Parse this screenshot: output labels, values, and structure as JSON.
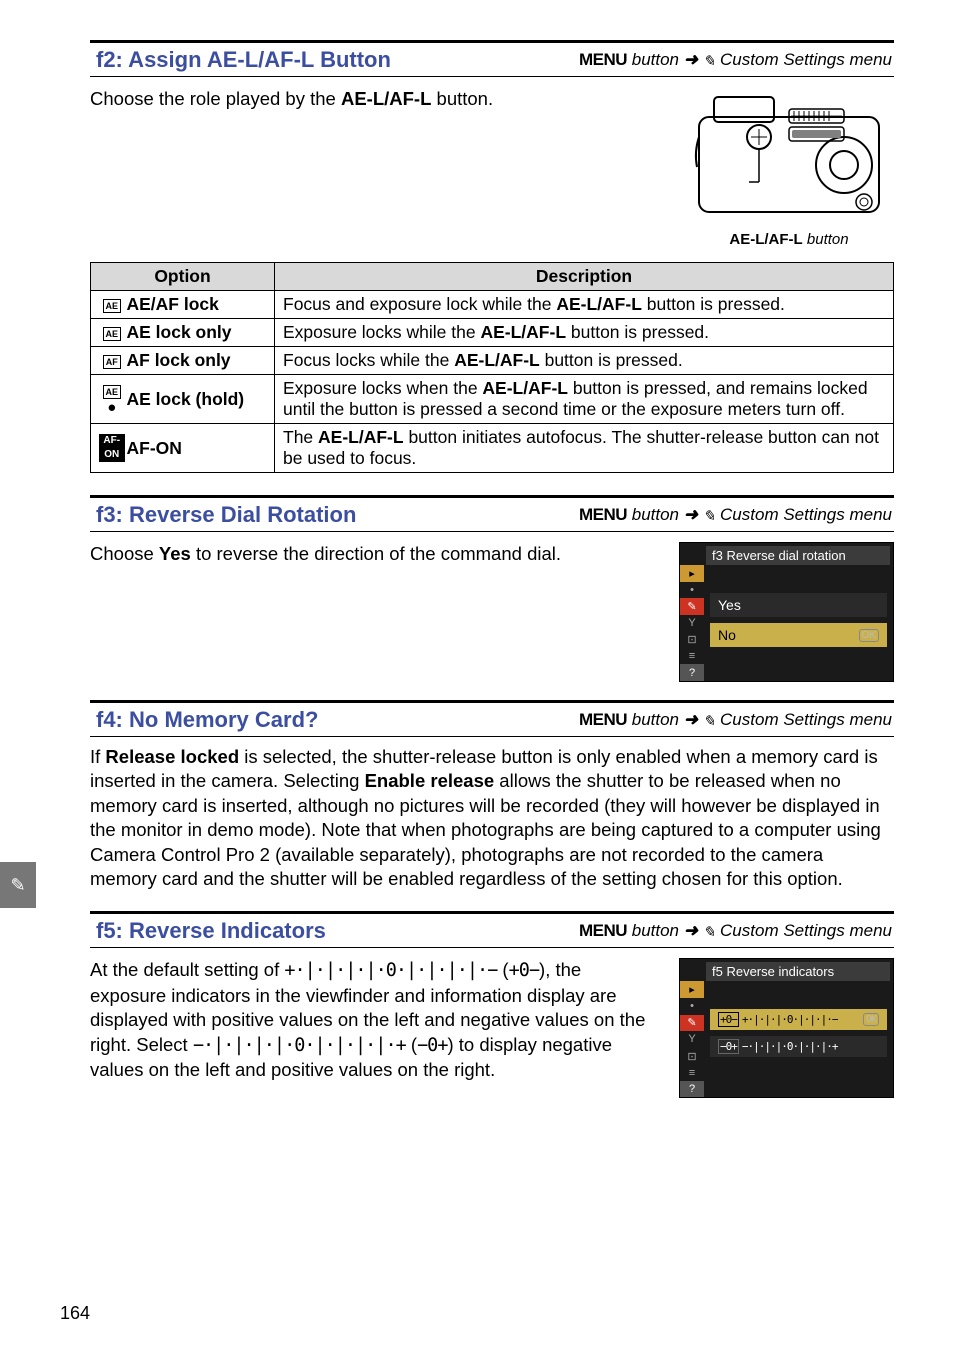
{
  "sidebar_glyph": "✎",
  "sections": {
    "f2": {
      "title": "f2: Assign AE-L/AF-L Button",
      "path_prefix": "MENU",
      "path_italic": "button",
      "path_arrow": "➜",
      "path_menu": "Custom Settings menu",
      "intro_before": "Choose the role played by the ",
      "intro_bold": "AE-L/AF-L",
      "intro_after": " button.",
      "button_caption_bold": "AE-L/AF-L",
      "button_caption_after": " button",
      "table": {
        "headers": {
          "option": "Option",
          "desc": "Description"
        },
        "rows": [
          {
            "icon": "AE-AF",
            "label": "AE/AF lock",
            "desc_pre": "Focus and exposure lock while the ",
            "desc_bold": "AE-L/AF-L",
            "desc_post": " button is pressed."
          },
          {
            "icon": "AE",
            "label": "AE lock only",
            "desc_pre": "Exposure locks while the ",
            "desc_bold": "AE-L/AF-L",
            "desc_post": " button is pressed."
          },
          {
            "icon": "AF",
            "label": "AF lock only",
            "desc_pre": "Focus locks while the ",
            "desc_bold": "AE-L/AF-L",
            "desc_post": " button is pressed."
          },
          {
            "icon": "AE-HOLD",
            "label": "AE lock (hold)",
            "desc_pre": "Exposure locks when the ",
            "desc_bold": "AE-L/AF-L",
            "desc_post": " button is pressed, and remains locked until the button is pressed a second time or the exposure meters turn off."
          },
          {
            "icon": "AF-ON",
            "label": "AF-ON",
            "desc_pre": "The ",
            "desc_bold": "AE-L/AF-L",
            "desc_post": " button initiates autofocus.  The shutter-release button can not be used to focus."
          }
        ]
      }
    },
    "f3": {
      "title": "f3: Reverse Dial Rotation",
      "path_prefix": "MENU",
      "path_italic": "button",
      "path_arrow": "➜",
      "path_menu": "Custom Settings menu",
      "intro_before": "Choose ",
      "intro_bold": "Yes",
      "intro_after": " to reverse the direction of the command dial.",
      "screenshot": {
        "title": "f3 Reverse dial rotation",
        "yes": "Yes",
        "no": "No",
        "ok": "OK"
      }
    },
    "f4": {
      "title": "f4: No Memory Card?",
      "path_prefix": "MENU",
      "path_italic": "button",
      "path_arrow": "➜",
      "path_menu": "Custom Settings menu",
      "body_parts": [
        "If ",
        {
          "b": "Release locked"
        },
        " is selected, the shutter-release button is only enabled when a memory card is inserted in the camera.  Selecting ",
        {
          "b": "Enable release"
        },
        " allows the shutter to be released when no memory card is inserted, although no pictures will be recorded (they will however be displayed in the monitor in demo mode).  Note that when photographs are being captured to a computer using Camera Control Pro 2 (available separately), photographs are not recorded to the camera memory card and the shutter will be enabled regardless of the setting chosen for this option."
      ]
    },
    "f5": {
      "title": "f5: Reverse Indicators",
      "path_prefix": "MENU",
      "path_italic": "button",
      "path_arrow": "➜",
      "path_menu": "Custom Settings menu",
      "body_parts": [
        "At the default setting of  ",
        {
          "m": "+·|·|·|·|·0·|·|·|·|·−"
        },
        "  (",
        {
          "m": "+0−"
        },
        "), the exposure indicators in the viewfinder and information display are displayed with positive values on the left and negative values on the right.  Select  ",
        {
          "m": "−·|·|·|·|·0·|·|·|·|·+"
        },
        "  (",
        {
          "m": "−0+"
        },
        ") to display negative values on the left and positive values on the right."
      ],
      "screenshot": {
        "title": "f5 Reverse indicators",
        "opt1_prefix": "+0−",
        "opt1": "+·|·|·|·0·|·|·|·−",
        "opt2_prefix": "−0+",
        "opt2": "−·|·|·|·0·|·|·|·+",
        "ok": "OK"
      }
    }
  },
  "page_number": "164"
}
